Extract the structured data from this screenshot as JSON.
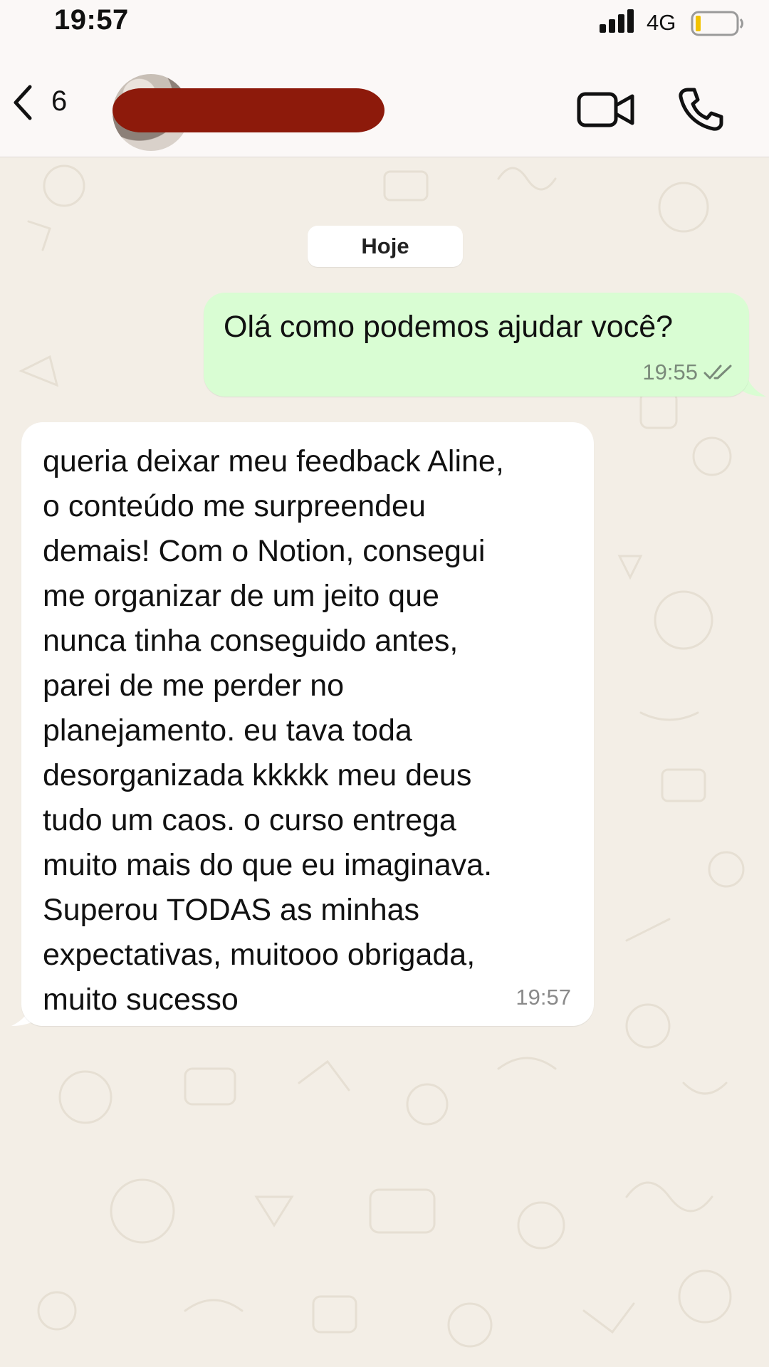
{
  "status_bar": {
    "time": "19:57",
    "network": "4G",
    "signal_icon": "cellular-signal-icon",
    "battery_icon": "battery-low-icon"
  },
  "header": {
    "unread_count": "6",
    "back_icon": "chevron-left-icon",
    "video_icon": "video-camera-icon",
    "phone_icon": "phone-icon",
    "redaction_color": "#8d1a0b"
  },
  "chat": {
    "date_label": "Hoje",
    "messages": [
      {
        "direction": "outgoing",
        "text": "Olá como podemos ajudar você?",
        "time": "19:55",
        "status_icon": "double-check-read-icon"
      },
      {
        "direction": "incoming",
        "text": "queria deixar meu feedback Aline,\no  conteúdo me surpreendeu\ndemais! Com o Notion, consegui\nme organizar de um jeito que\nnunca tinha conseguido antes,\nparei de me perder no\nplanejamento. eu tava toda\ndesorganizada kkkkk meu deus\ntudo um caos. o curso entrega\nmuito mais do que eu imaginava.\nSuperou TODAS as minhas\nexpectativas, muitooo obrigada,\nmuito sucesso",
        "time": "19:57"
      }
    ]
  },
  "colors": {
    "outgoing_bubble": "#d9fdd3",
    "incoming_bubble": "#ffffff",
    "wallpaper": "#f3eee6"
  }
}
